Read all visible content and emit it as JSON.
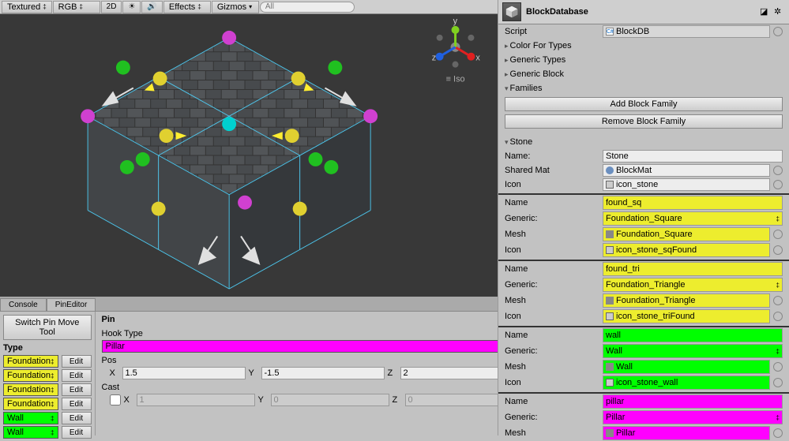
{
  "scene_toolbar": {
    "shading": "Textured",
    "channel": "RGB",
    "dim": "2D",
    "effects": "Effects",
    "gizmos": "Gizmos",
    "search_placeholder": "All"
  },
  "viewport_overlay": {
    "mode": "Iso",
    "axis_x": "x",
    "axis_y": "y",
    "axis_z": "z"
  },
  "bottom_tabs": {
    "console": "Console",
    "pineditor": "PinEditor"
  },
  "pineditor": {
    "switch_btn": "Switch Pin Move Tool",
    "type_header": "Type",
    "edit_btn": "Edit",
    "rows": [
      {
        "label": "Foundation",
        "color": "yellow"
      },
      {
        "label": "Foundation",
        "color": "yellow"
      },
      {
        "label": "Foundation",
        "color": "yellow"
      },
      {
        "label": "Foundation",
        "color": "yellow"
      },
      {
        "label": "Wall",
        "color": "green"
      },
      {
        "label": "Wall",
        "color": "green"
      }
    ],
    "pin_title": "Pin",
    "hook_type_label": "Hook Type",
    "hook_type_value": "Pillar",
    "pos_label": "Pos",
    "pos": {
      "x": "1.5",
      "y": "-1.5",
      "z": "2"
    },
    "cast_label": "Cast",
    "cast_checked": false,
    "cast": {
      "x": "1",
      "y": "0",
      "z": "0"
    }
  },
  "inspector": {
    "title": "BlockDatabase",
    "script_label": "Script",
    "script_value": "BlockDB",
    "color_for_types": "Color For Types",
    "generic_types": "Generic Types",
    "generic_block": "Generic Block",
    "families": "Families",
    "add_family": "Add Block Family",
    "remove_family": "Remove Block Family",
    "stone": {
      "header": "Stone",
      "name_label": "Name:",
      "name_value": "Stone",
      "shared_mat_label": "Shared Mat",
      "shared_mat_value": "BlockMat",
      "icon_label": "Icon",
      "icon_value": "icon_stone"
    },
    "blocks": [
      {
        "color": "yellow",
        "rows": [
          {
            "label": "Name",
            "value": "found_sq",
            "icon": ""
          },
          {
            "label": "Generic:",
            "value": "Foundation_Square",
            "dropdown": true
          },
          {
            "label": "Mesh",
            "value": "Foundation_Square",
            "icon": "mesh",
            "circle": true
          },
          {
            "label": "Icon",
            "value": "icon_stone_sqFound",
            "icon": "sprite",
            "circle": true
          }
        ]
      },
      {
        "color": "yellow",
        "rows": [
          {
            "label": "Name",
            "value": "found_tri",
            "icon": ""
          },
          {
            "label": "Generic:",
            "value": "Foundation_Triangle",
            "dropdown": true
          },
          {
            "label": "Mesh",
            "value": "Foundation_Triangle",
            "icon": "mesh",
            "circle": true
          },
          {
            "label": "Icon",
            "value": "icon_stone_triFound",
            "icon": "sprite",
            "circle": true
          }
        ]
      },
      {
        "color": "green",
        "rows": [
          {
            "label": "Name",
            "value": "wall",
            "icon": ""
          },
          {
            "label": "Generic:",
            "value": "Wall",
            "dropdown": true
          },
          {
            "label": "Mesh",
            "value": "Wall",
            "icon": "mesh",
            "circle": true
          },
          {
            "label": "Icon",
            "value": "icon_stone_wall",
            "icon": "sprite",
            "circle": true
          }
        ]
      },
      {
        "color": "magenta",
        "rows": [
          {
            "label": "Name",
            "value": "pillar",
            "icon": ""
          },
          {
            "label": "Generic:",
            "value": "Pillar",
            "dropdown": true
          },
          {
            "label": "Mesh",
            "value": "Pillar",
            "icon": "mesh",
            "circle": true
          }
        ]
      }
    ]
  }
}
